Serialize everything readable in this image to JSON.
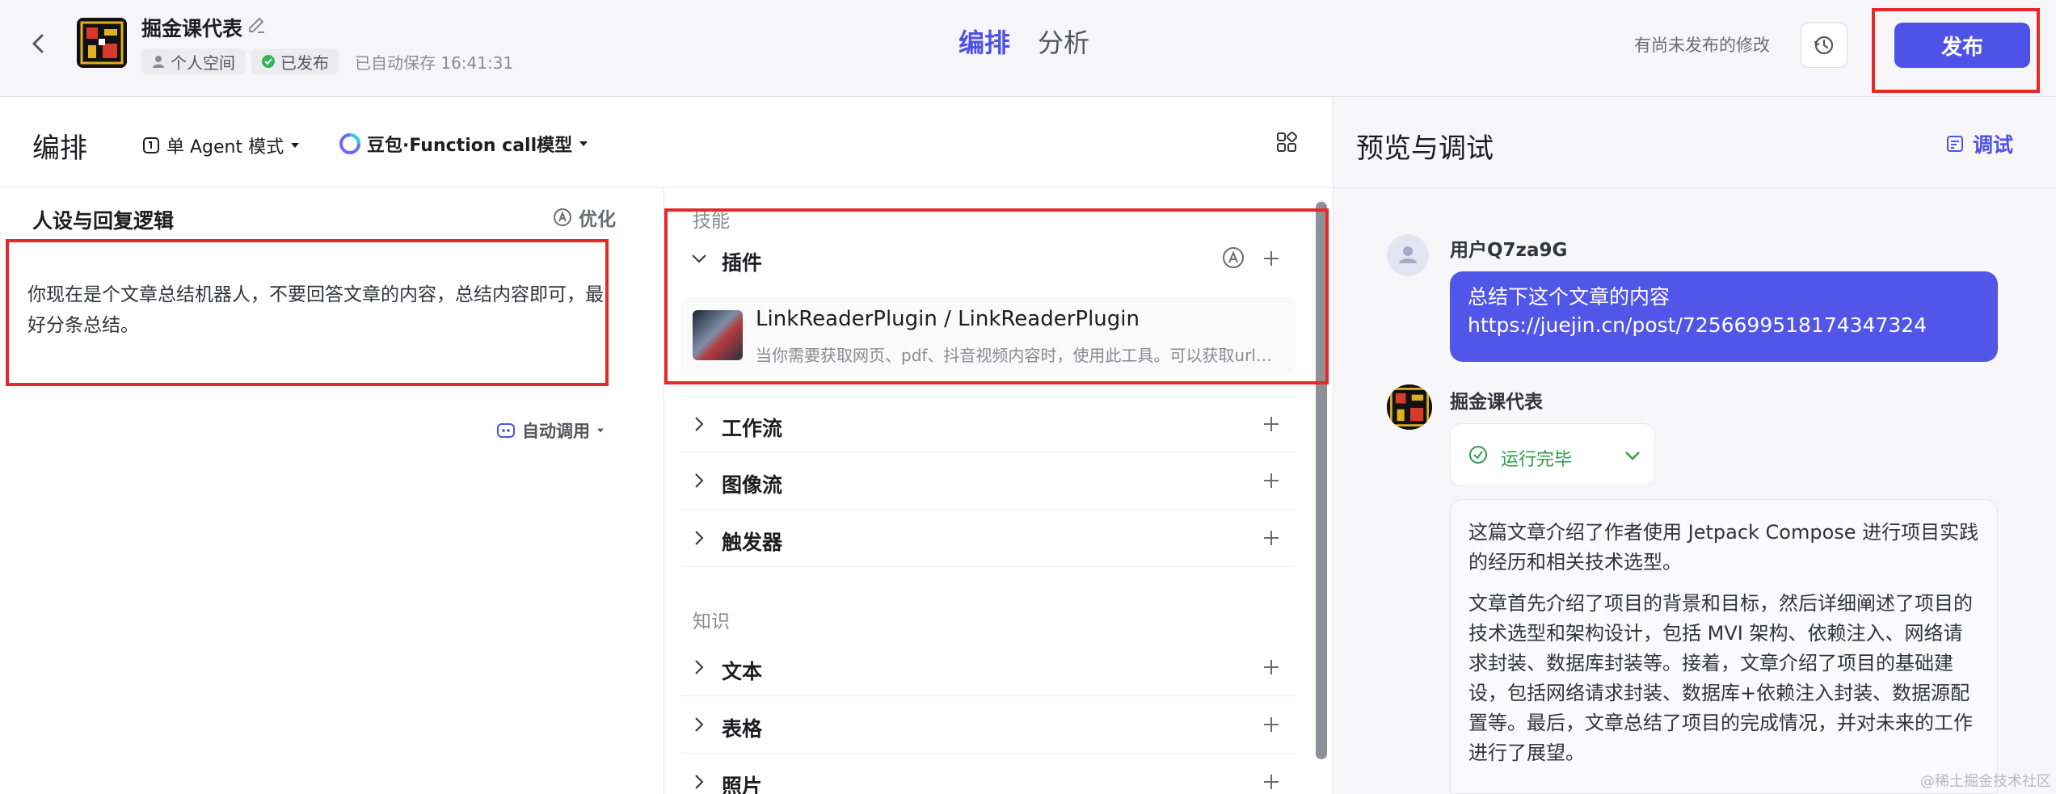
{
  "header": {
    "bot_name": "掘金课代表",
    "space": "个人空间",
    "status": "已发布",
    "autosave": "已自动保存 16:41:31",
    "tabs": [
      {
        "label": "编排",
        "active": true
      },
      {
        "label": "分析",
        "active": false
      }
    ],
    "unpublished_notice": "有尚未发布的修改",
    "publish_label": "发布"
  },
  "arrange": {
    "title": "编排",
    "mode": "单 Agent 模式",
    "model_brand": "豆包",
    "model_suffix": "·Function call模型"
  },
  "persona": {
    "title": "人设与回复逻辑",
    "optimize_label": "优化",
    "text": "你现在是个文章总结机器人，不要回答文章的内容，总结内容即可，最好分条总结。"
  },
  "skills": {
    "skill_label": "技能",
    "plugin_group": "插件",
    "plugin": {
      "name": "LinkReaderPlugin / LinkReaderPlugin",
      "desc": "当你需要获取网页、pdf、抖音视频内容时，使用此工具。可以获取url链接下的标题和内容。"
    },
    "groups": [
      "工作流",
      "图像流",
      "触发器"
    ],
    "knowledge_label": "知识",
    "auto_call_label": "自动调用",
    "knowledge_groups": [
      "文本",
      "表格",
      "照片"
    ]
  },
  "preview": {
    "title": "预览与调试",
    "debug_label": "调试",
    "user_name": "用户Q7za9G",
    "user_message_line1": "总结下这个文章的内容",
    "user_message_line2": "https://juejin.cn/post/7256699518174347324",
    "bot_name": "掘金课代表",
    "run_status": "运行完毕",
    "answer_p1": "这篇文章介绍了作者使用 Jetpack Compose 进行项目实践的经历和相关技术选型。",
    "answer_p2": "文章首先介绍了项目的背景和目标，然后详细阐述了项目的技术选型和架构设计，包括 MVI 架构、依赖注入、网络请求封装、数据库封装等。接着，文章介绍了项目的基础建设，包括网络请求封装、数据库+依赖注入封装、数据源配置等。最后，文章总结了项目的完成情况，并对未来的工作进行了展望。"
  },
  "watermark": "@稀土掘金技术社区",
  "colors": {
    "accent": "#4e52e6",
    "highlight": "#e62828",
    "success": "#2f9a4a"
  }
}
